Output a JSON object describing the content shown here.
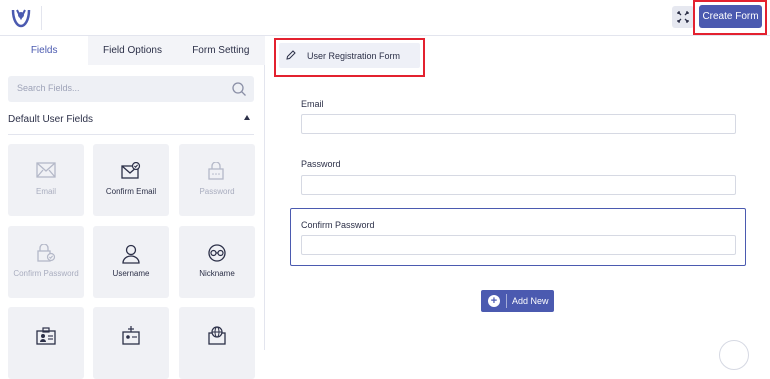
{
  "header": {
    "create_button_label": "Create Form",
    "logo_icon": "user-registration-logo-icon",
    "expand_icon": "expand-icon"
  },
  "tabs": [
    {
      "label": "Fields",
      "active": true
    },
    {
      "label": "Field Options",
      "active": false
    },
    {
      "label": "Form Setting",
      "active": false
    }
  ],
  "search": {
    "placeholder": "Search Fields..."
  },
  "section": {
    "title": "Default User Fields"
  },
  "fields": [
    {
      "label": "Email",
      "icon": "envelope-icon",
      "disabled": true
    },
    {
      "label": "Confirm Email",
      "icon": "envelope-check-icon",
      "disabled": false
    },
    {
      "label": "Password",
      "icon": "lock-icon",
      "disabled": true
    },
    {
      "label": "Confirm Password",
      "icon": "lock-check-icon",
      "disabled": true
    },
    {
      "label": "Username",
      "icon": "user-icon",
      "disabled": false
    },
    {
      "label": "Nickname",
      "icon": "mask-icon",
      "disabled": false
    },
    {
      "label": "",
      "icon": "id-card-icon",
      "disabled": false
    },
    {
      "label": "",
      "icon": "badge-icon",
      "disabled": false
    },
    {
      "label": "",
      "icon": "globe-screen-icon",
      "disabled": false
    }
  ],
  "form": {
    "title": "User Registration Form",
    "fields": [
      {
        "label": "Email",
        "value": ""
      },
      {
        "label": "Password",
        "value": ""
      },
      {
        "label": "Confirm Password",
        "value": ""
      }
    ],
    "add_new_label": "Add New"
  },
  "colors": {
    "accent": "#4b5ab0",
    "highlight": "#e3212f"
  }
}
